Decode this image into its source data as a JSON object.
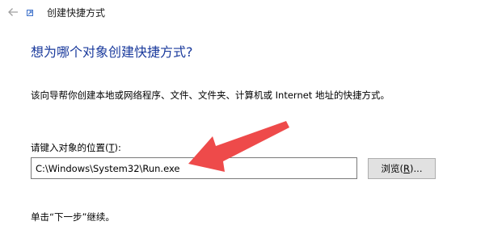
{
  "window": {
    "title": "创建快捷方式",
    "back_icon": "arrow-left-icon",
    "app_icon": "shortcut-icon"
  },
  "main": {
    "heading": "想为哪个对象创建快捷方式?",
    "description": "该向导帮你创建本地或网络程序、文件、文件夹、计算机或 Internet 地址的快捷方式。",
    "location_label_prefix": "请键入对象的位置(",
    "location_label_key": "T",
    "location_label_suffix": "):",
    "location_value": "C:\\Windows\\System32\\Run.exe",
    "browse_label_prefix": "浏览(",
    "browse_label_key": "R",
    "browse_label_suffix": ")...",
    "footer": "单击“下一步”继续。"
  },
  "annotation": {
    "arrow_color": "#ee4a4a"
  },
  "colors": {
    "heading": "#1a3a9c",
    "input_border": "#7a7a7a",
    "button_bg": "#e1e1e1"
  }
}
